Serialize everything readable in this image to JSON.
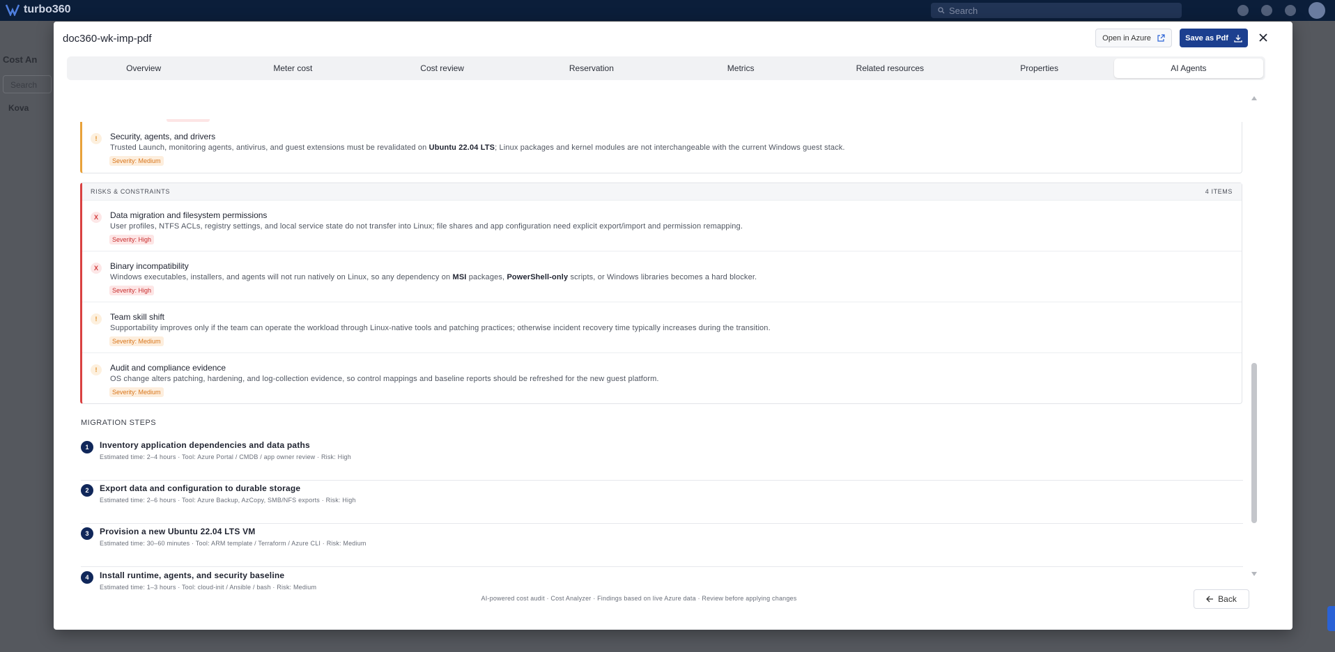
{
  "app": {
    "name": "turbo360",
    "search_placeholder": "Search"
  },
  "background": {
    "crumb": "Cost An",
    "search_placeholder": "Search",
    "tree_label": "Kova"
  },
  "modal": {
    "title": "doc360-wk-imp-pdf",
    "open_azure_label": "Open in Azure",
    "save_pdf_label": "Save as Pdf",
    "tabs": [
      {
        "label": "Overview"
      },
      {
        "label": "Meter cost"
      },
      {
        "label": "Cost review"
      },
      {
        "label": "Reservation"
      },
      {
        "label": "Metrics"
      },
      {
        "label": "Related resources"
      },
      {
        "label": "Properties"
      },
      {
        "label": "AI Agents",
        "active": true
      }
    ]
  },
  "findings_partial": {
    "title": "Security, agents, and drivers",
    "desc_before": "Trusted Launch, monitoring agents, antivirus, and guest extensions must be revalidated on ",
    "desc_bold": "Ubuntu 22.04 LTS",
    "desc_after": "; Linux packages and kernel modules are not interchangeable with the current Windows guest stack.",
    "severity": "Severity: Medium",
    "icon": "!"
  },
  "risks": {
    "heading": "RISKS & CONSTRAINTS",
    "count": "4 ITEMS",
    "items": [
      {
        "icon": "X",
        "title": "Data migration and filesystem permissions",
        "desc": "User profiles, NTFS ACLs, registry settings, and local service state do not transfer into Linux; file shares and app configuration need explicit export/import and permission remapping.",
        "severity": "Severity: High"
      },
      {
        "icon": "X",
        "title": "Binary incompatibility",
        "desc_before": "Windows executables, installers, and agents will not run natively on Linux, so any dependency on ",
        "desc_bold1": "MSI",
        "desc_mid": " packages, ",
        "desc_bold2": "PowerShell-only",
        "desc_after": " scripts, or Windows libraries becomes a hard blocker.",
        "severity": "Severity: High"
      },
      {
        "icon": "!",
        "title": "Team skill shift",
        "desc": "Supportability improves only if the team can operate the workload through Linux-native tools and patching practices; otherwise incident recovery time typically increases during the transition.",
        "severity": "Severity: Medium"
      },
      {
        "icon": "!",
        "title": "Audit and compliance evidence",
        "desc": "OS change alters patching, hardening, and log-collection evidence, so control mappings and baseline reports should be refreshed for the new guest platform.",
        "severity": "Severity: Medium"
      }
    ]
  },
  "migration": {
    "heading": "MIGRATION STEPS",
    "steps": [
      {
        "num": "1",
        "title": "Inventory application dependencies and data paths",
        "meta": "Estimated time: 2–4 hours · Tool: Azure Portal / CMDB / app owner review · Risk: High"
      },
      {
        "num": "2",
        "title": "Export data and configuration to durable storage",
        "meta": "Estimated time: 2–6 hours · Tool: Azure Backup, AzCopy, SMB/NFS exports · Risk: High"
      },
      {
        "num": "3",
        "title": "Provision a new Ubuntu 22.04 LTS VM",
        "meta": "Estimated time: 30–60 minutes · Tool: ARM template / Terraform / Azure CLI · Risk: Medium"
      },
      {
        "num": "4",
        "title": "Install runtime, agents, and security baseline",
        "meta": "Estimated time: 1–3 hours · Tool: cloud-init / Ansible / bash · Risk: Medium"
      }
    ]
  },
  "footer": {
    "note": "AI-powered cost audit · Cost Analyzer · Findings based on live Azure data · Review before applying changes",
    "back_label": "Back"
  }
}
